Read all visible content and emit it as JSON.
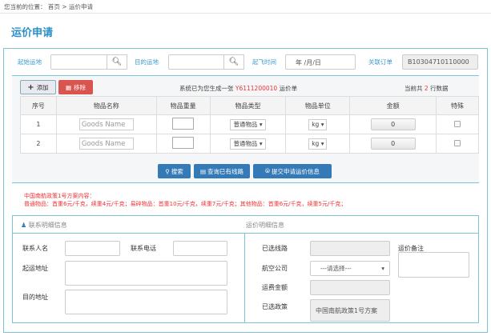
{
  "breadcrumb": {
    "prefix": "您当前的位置：",
    "home": "首页",
    "sep": ">",
    "current": "运价申请"
  },
  "page_title": "运价申请",
  "search": {
    "origin_label": "起始运地",
    "origin_value": "",
    "dest_label": "目的运地",
    "dest_value": "",
    "date_label": "起飞时间",
    "date_placeholder": "年 /月/日",
    "order_label": "关联订单",
    "order_value": "B10304710110000"
  },
  "toolbar": {
    "add_label": "添加",
    "delete_label": "移除",
    "message_prefix": "系统已为您生成一张",
    "order_no": "Y6111200010",
    "message_suffix": "运价单",
    "count_prefix": "当前共",
    "count": "2",
    "count_suffix": "行数据"
  },
  "table": {
    "headers": [
      "序号",
      "物品名称",
      "物品重量",
      "物品类型",
      "物品单位",
      "金额",
      "特殊"
    ],
    "rows": [
      {
        "no": "1",
        "name_placeholder": "Goods Name",
        "type": "普通物品",
        "unit": "kg",
        "amount": "0"
      },
      {
        "no": "2",
        "name_placeholder": "Goods Name",
        "type": "普通物品",
        "unit": "kg",
        "amount": "0"
      }
    ]
  },
  "actions": {
    "search": "搜索",
    "query_routes": "查询已有线路",
    "submit": "提交申请运价信息"
  },
  "policy": {
    "title": "中国南航政策1号方案内容：",
    "content": "普通物品：首重6元/千克，续重4元/千克；易碎物品：首重10元/千克，续重7元/千克；其他物品：首重6元/千克，续重5元/千克；"
  },
  "contact": {
    "header": "联系明细信息",
    "name_label": "联系人名",
    "phone_label": "联系电话",
    "from_label": "起运地址",
    "to_label": "目的地址"
  },
  "freight": {
    "header": "运价明细信息",
    "route_label": "已选线路",
    "airline_label": "航空公司",
    "airline_value": "---请选择---",
    "fee_label": "运费金额",
    "policy_label": "已选政策",
    "policy_value": "中国南航政策1号方案",
    "remark_label": "运价备注"
  },
  "colors": {
    "accent": "#2a8fc7",
    "danger": "#d9534f",
    "primary_btn": "#337ab7",
    "highlight": "#e33333"
  }
}
